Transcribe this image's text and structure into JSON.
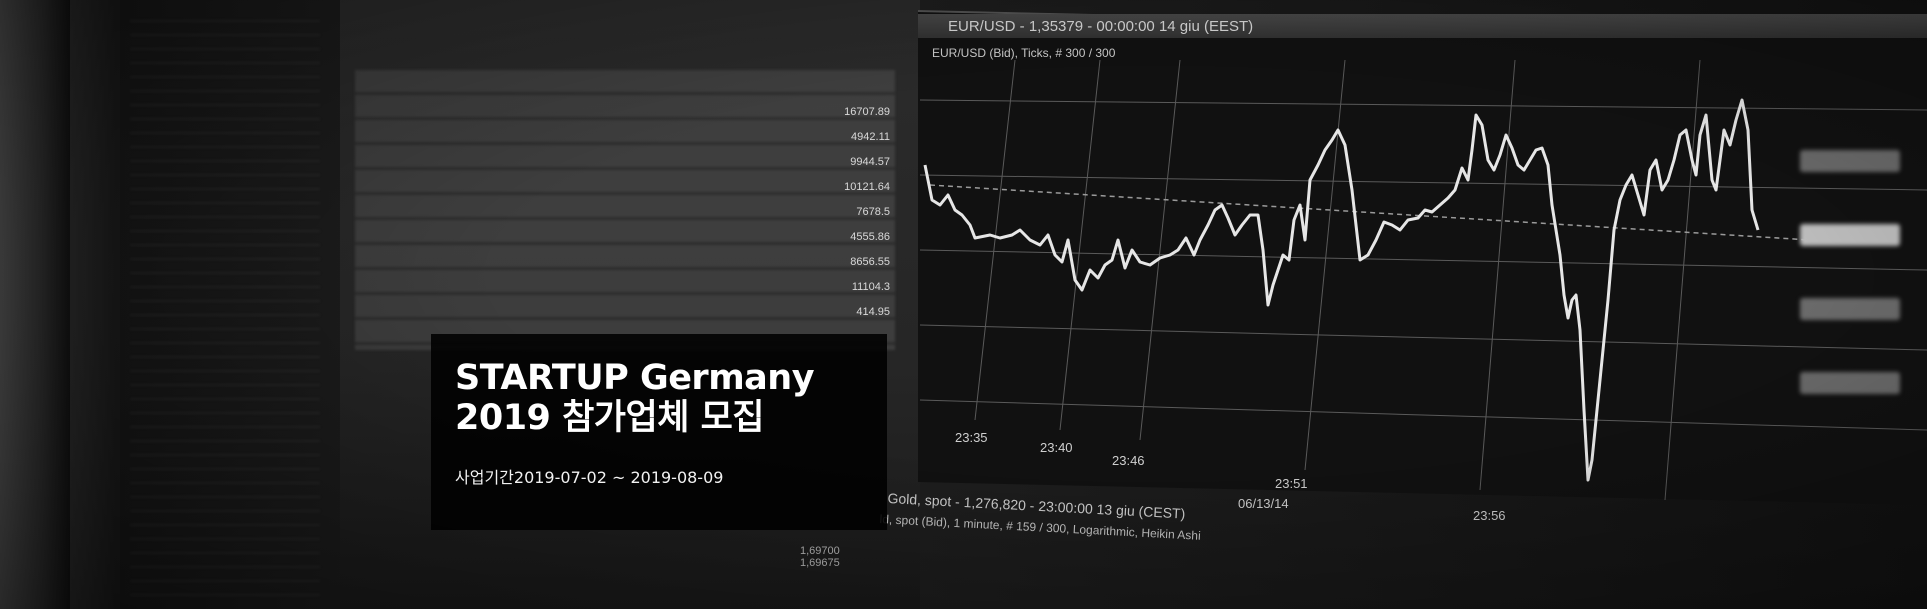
{
  "banner": {
    "title_line1": "STARTUP Germany",
    "title_line2": "2019 참가업체 모집",
    "period_label": "사업기간",
    "period_value": "2019-07-02 ~ 2019-08-09"
  },
  "chart_window": {
    "title": "EUR/USD - 1,35379 - 00:00:00  14 giu (EEST)",
    "subtitle": "EUR/USD (Bid), Ticks, # 300 / 300",
    "time_labels": [
      "23:35",
      "23:40",
      "23:46",
      "23:51",
      "06/13/14",
      "23:56"
    ]
  },
  "bottom_window": {
    "title": "Gold, spot - 1,276,820 - 23:00:00  13 giu (CEST)",
    "subtitle": "ld, spot (Bid), 1 minute, # 159 / 300, Logarithmic, Heikin Ashi",
    "values": [
      "1,69700",
      "1,69675"
    ]
  },
  "table_values": [
    "16707.89",
    "4942.11",
    "9944.57",
    "10121.64",
    "7678.5",
    "4555.86",
    "8656.55",
    "11104.3",
    "414.95"
  ],
  "colors": {
    "overlay": "#000000",
    "banner_text": "#ffffff"
  }
}
